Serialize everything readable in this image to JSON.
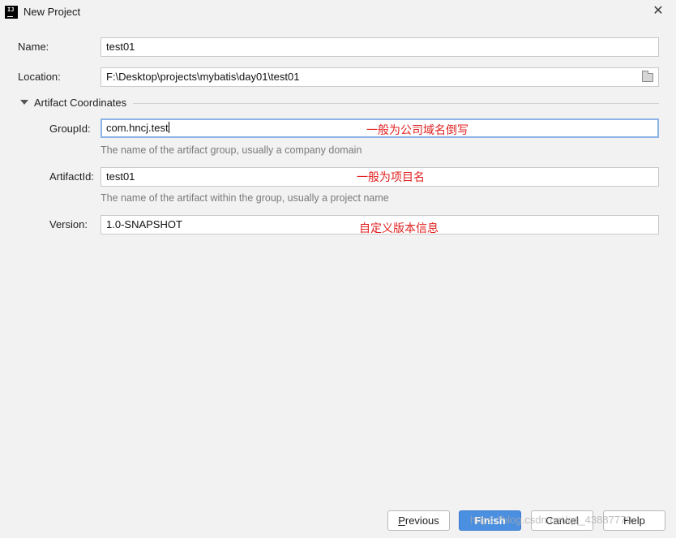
{
  "window": {
    "title": "New Project",
    "app_icon_text": "IJ",
    "close_symbol": "✕"
  },
  "form": {
    "name": {
      "label": "Name:",
      "value": "test01"
    },
    "location": {
      "label": "Location:",
      "value": "F:\\Desktop\\projects\\mybatis\\day01\\test01",
      "icon": "folder-icon"
    }
  },
  "artifact": {
    "section_title": "Artifact Coordinates",
    "expanded": true,
    "group_id": {
      "label": "GroupId:",
      "value": "com.hncj.test",
      "hint": "The name of the artifact group, usually a company domain",
      "annotation": "一般为公司域名倒写"
    },
    "artifact_id": {
      "label": "ArtifactId:",
      "value": "test01",
      "hint": "The name of the artifact within the group, usually a project name",
      "annotation": "一般为项目名"
    },
    "version": {
      "label": "Version:",
      "value": "1.0-SNAPSHOT",
      "annotation": "自定义版本信息"
    }
  },
  "buttons": {
    "previous": {
      "mnemonic": "P",
      "rest": "revious"
    },
    "finish": "Finish",
    "cancel": "Cancel",
    "help": "Help"
  },
  "watermark": "https://blog.csdn.net/qq_43887779",
  "colors": {
    "background": "#f2f2f2",
    "focus_border": "#8cb4e6",
    "primary_button": "#4a8fe0",
    "annotation": "#e02020",
    "hint_text": "#7a7a7a"
  }
}
